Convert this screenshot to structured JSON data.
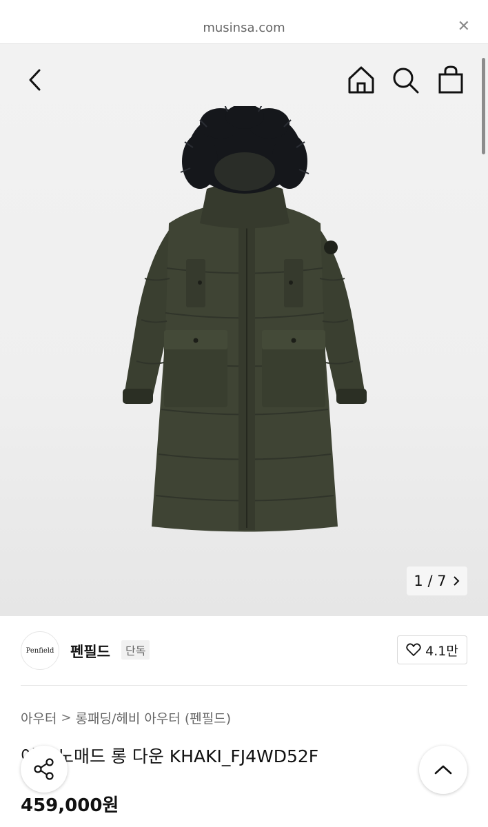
{
  "browser": {
    "url": "musinsa.com",
    "close_icon": "close-icon"
  },
  "hero": {
    "pager_text": "1 / 7",
    "icons": [
      "back-chevron-icon",
      "home-icon",
      "search-icon",
      "shopping-bag-icon"
    ]
  },
  "brand": {
    "logo_text": "Penfield",
    "name": "펜필드",
    "exclusive_badge": "단독",
    "like_count": "4.1만"
  },
  "breadcrumb": {
    "level1": "아우터",
    "separator": ">",
    "level2": "롱패딩/헤비 아우터 (펜필드)"
  },
  "product": {
    "title": "여성 노매드 롱 다운 KHAKI_FJ4WD52F",
    "price": "459,000원"
  },
  "colors": {
    "coat": "#3d4232",
    "fur": "#15171b",
    "text": "#111111",
    "muted": "#666666"
  }
}
